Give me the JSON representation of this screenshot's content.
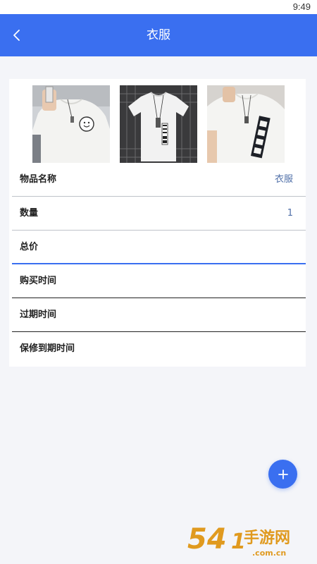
{
  "status_bar": {
    "time": "9:49"
  },
  "header": {
    "title": "衣服",
    "back_icon": "chevron-left-icon"
  },
  "photos": [
    {
      "name": "photo-tshirt-smiley",
      "alt": ""
    },
    {
      "name": "photo-tshirt-graphic",
      "alt": ""
    },
    {
      "name": "photo-tshirt-side-print",
      "alt": ""
    }
  ],
  "form": {
    "item_name": {
      "label": "物品名称",
      "value": "衣服"
    },
    "quantity": {
      "label": "数量",
      "value": "1"
    },
    "total_price": {
      "label": "总价",
      "value": ""
    },
    "purchase_time": {
      "label": "购买时间",
      "value": ""
    },
    "expiry_time": {
      "label": "过期时间",
      "value": ""
    },
    "warranty_expiry_time": {
      "label": "保修到期时间",
      "value": ""
    }
  },
  "fab": {
    "icon": "plus-icon"
  },
  "watermark": {
    "text": "54手游网",
    "domain": ".com.cn"
  },
  "colors": {
    "primary": "#3a6ff0",
    "background": "#f4f5f9",
    "value_text": "#4f6fa8",
    "watermark": "#e09a1f"
  }
}
